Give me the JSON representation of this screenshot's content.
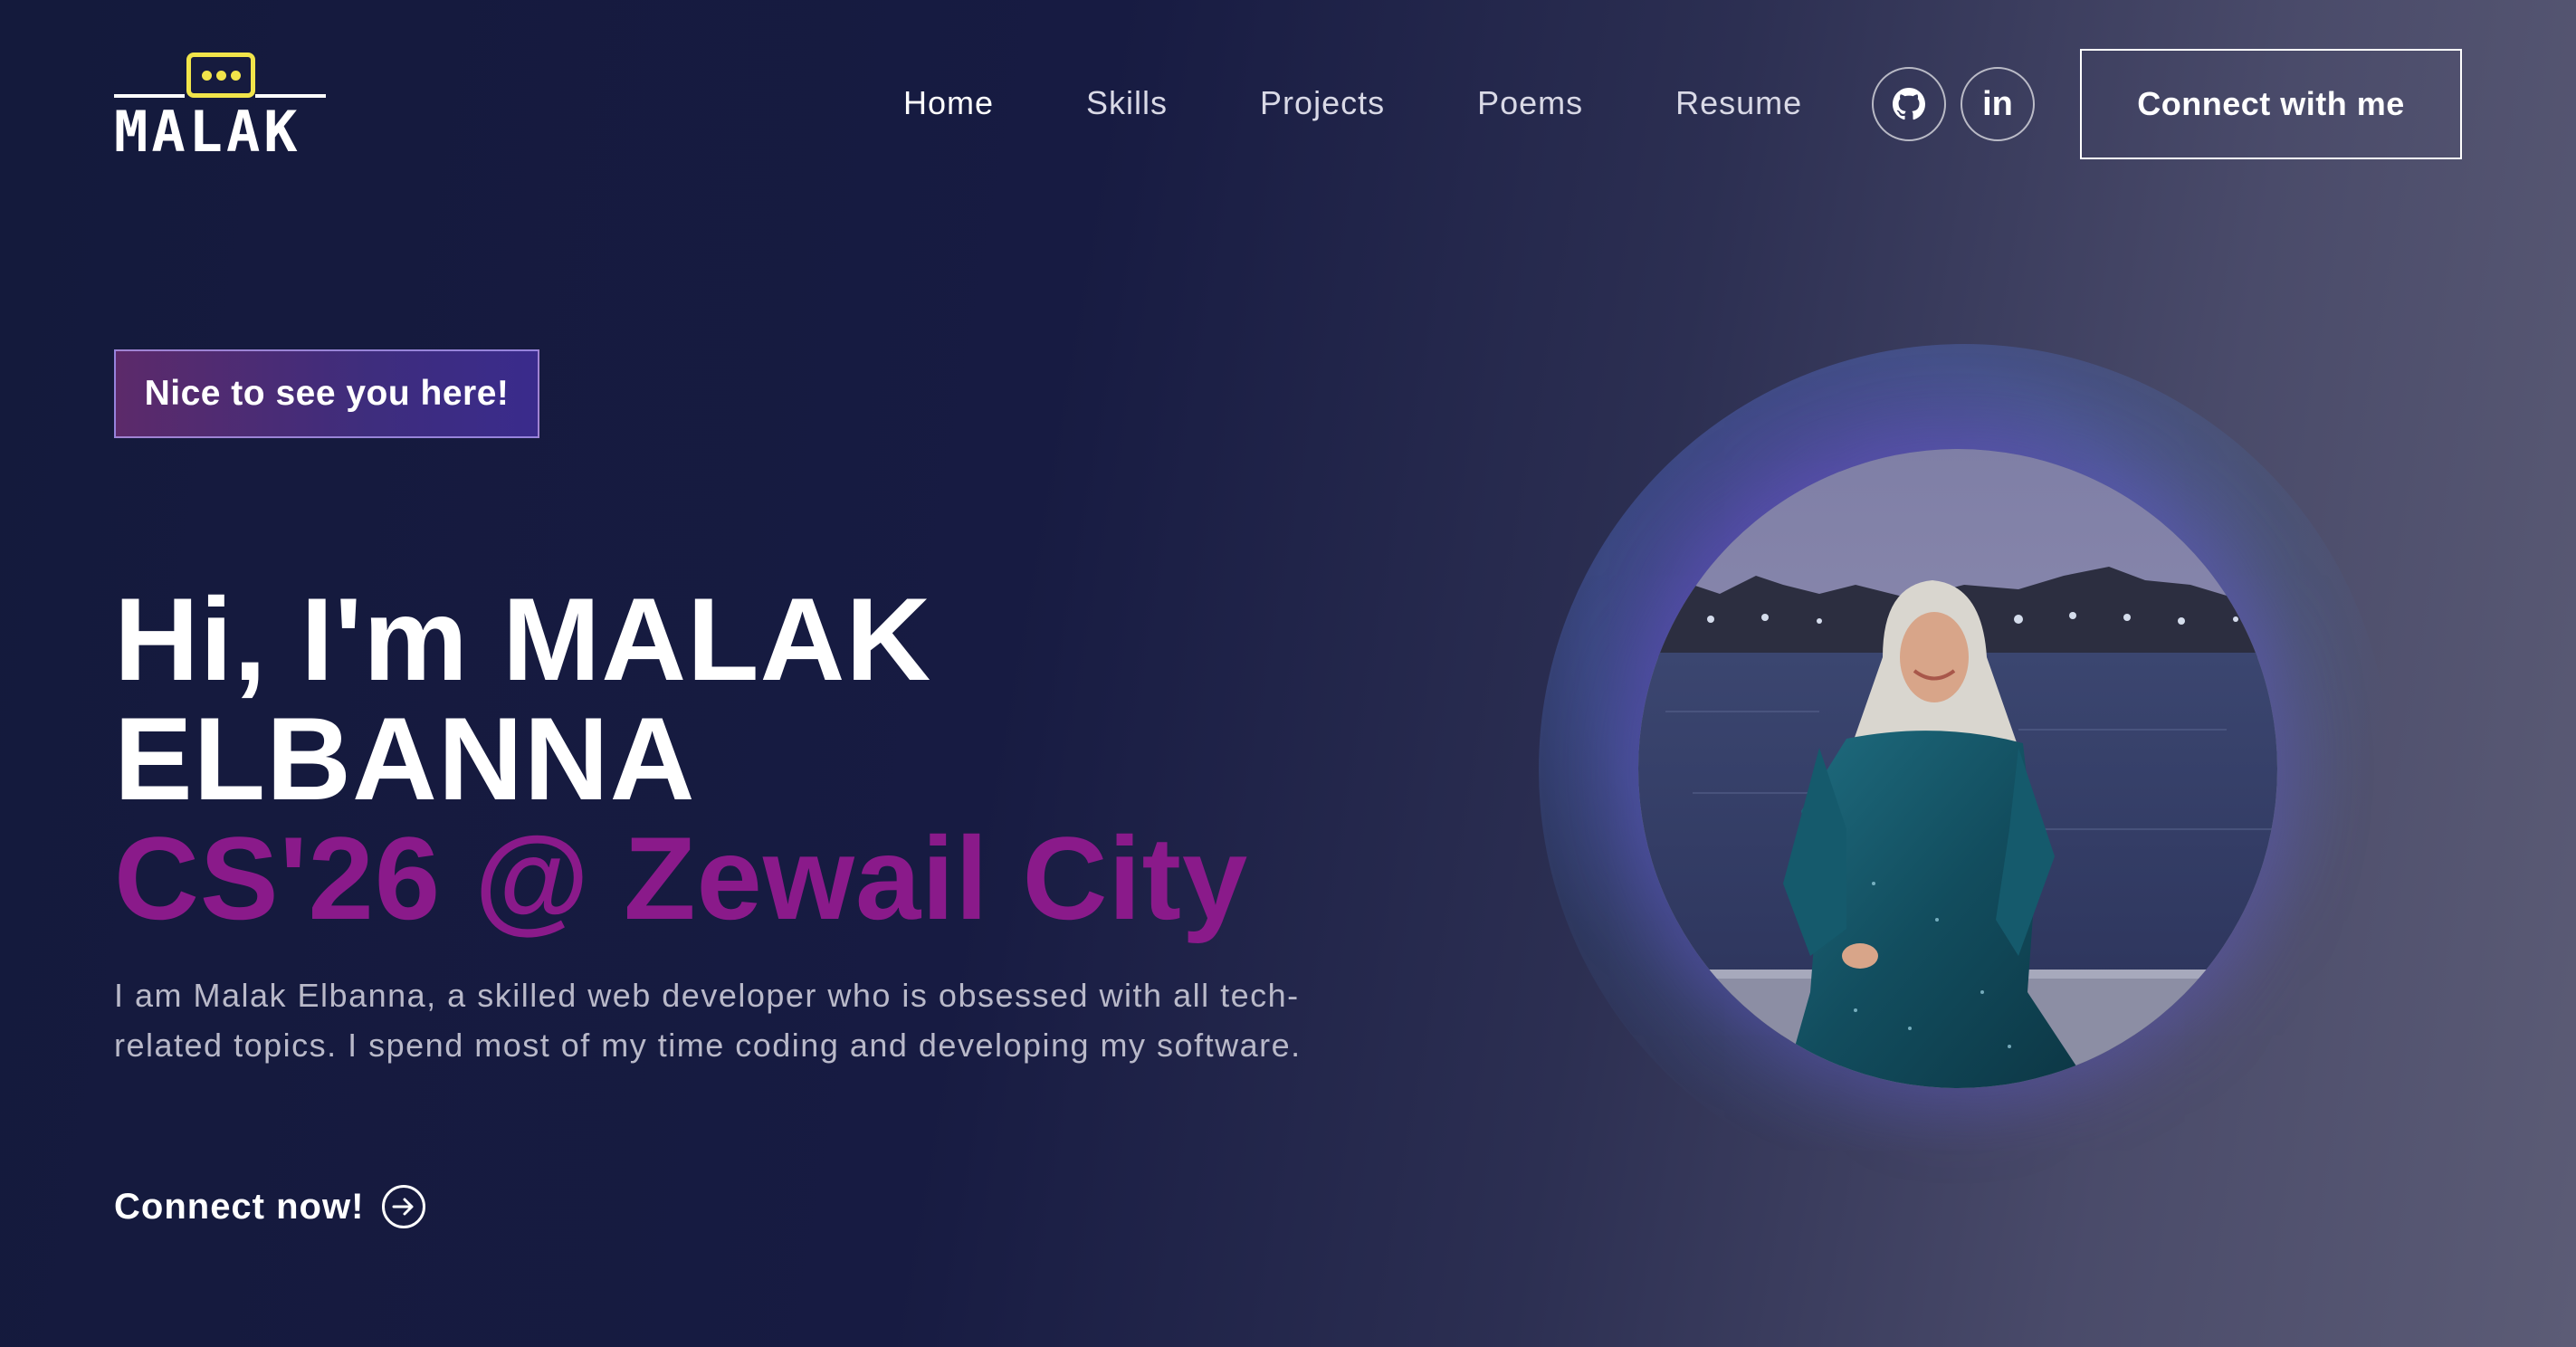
{
  "logo": {
    "text": "MALAK"
  },
  "nav": {
    "items": [
      {
        "label": "Home",
        "active": true
      },
      {
        "label": "Skills",
        "active": false
      },
      {
        "label": "Projects",
        "active": false
      },
      {
        "label": "Poems",
        "active": false
      },
      {
        "label": "Resume",
        "active": false
      }
    ],
    "social": [
      {
        "icon": "github-icon"
      },
      {
        "icon": "linkedin-icon",
        "text": "in"
      }
    ],
    "cta_label": "Connect with me"
  },
  "hero": {
    "tagline": "Nice to see you here!",
    "title_line1": "Hi, I'm MALAK",
    "title_line2": "ELBANNA",
    "subtitle": "CS'26 @ Zewail City",
    "description": "I am Malak Elbanna, a skilled web developer who is obsessed with all tech-related topics. I spend most of my time coding and developing my software.",
    "connect_label": "Connect now!"
  },
  "colors": {
    "accent_purple": "#8a1a8a",
    "logo_yellow": "#f1e44a",
    "background_dark": "#151a3e"
  }
}
